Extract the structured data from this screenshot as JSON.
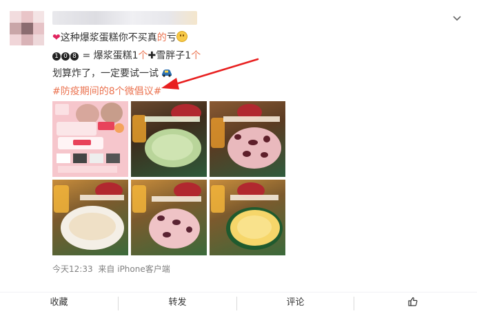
{
  "post": {
    "text": {
      "line1_heart": "❤",
      "line1_text_a": "这种爆浆蛋糕你不买真",
      "line1_text_red": "的",
      "line1_text_b": "亏",
      "line2_nums": [
        "1",
        "0",
        "8"
      ],
      "line2_text_a": "= 爆浆蛋糕1",
      "line2_unit_a": "个",
      "line2_plus": "✚",
      "line2_text_b": "雪胖子1",
      "line2_unit_b": "个",
      "line3_text": "划算炸了，一定要试一试",
      "hashtag": "#防疫期间的8个微倡议#"
    },
    "meta": {
      "time": "今天12:33",
      "source": "来自 iPhone客户端"
    }
  },
  "actions": {
    "favorite": "收藏",
    "repost": "转发",
    "comment": "评论"
  },
  "colors": {
    "link": "#eb7350",
    "meta": "#808080",
    "text": "#333333"
  },
  "icons": {
    "more": "chevron-down-icon",
    "like": "thumbs-up-icon",
    "annotation": "red-arrow"
  }
}
